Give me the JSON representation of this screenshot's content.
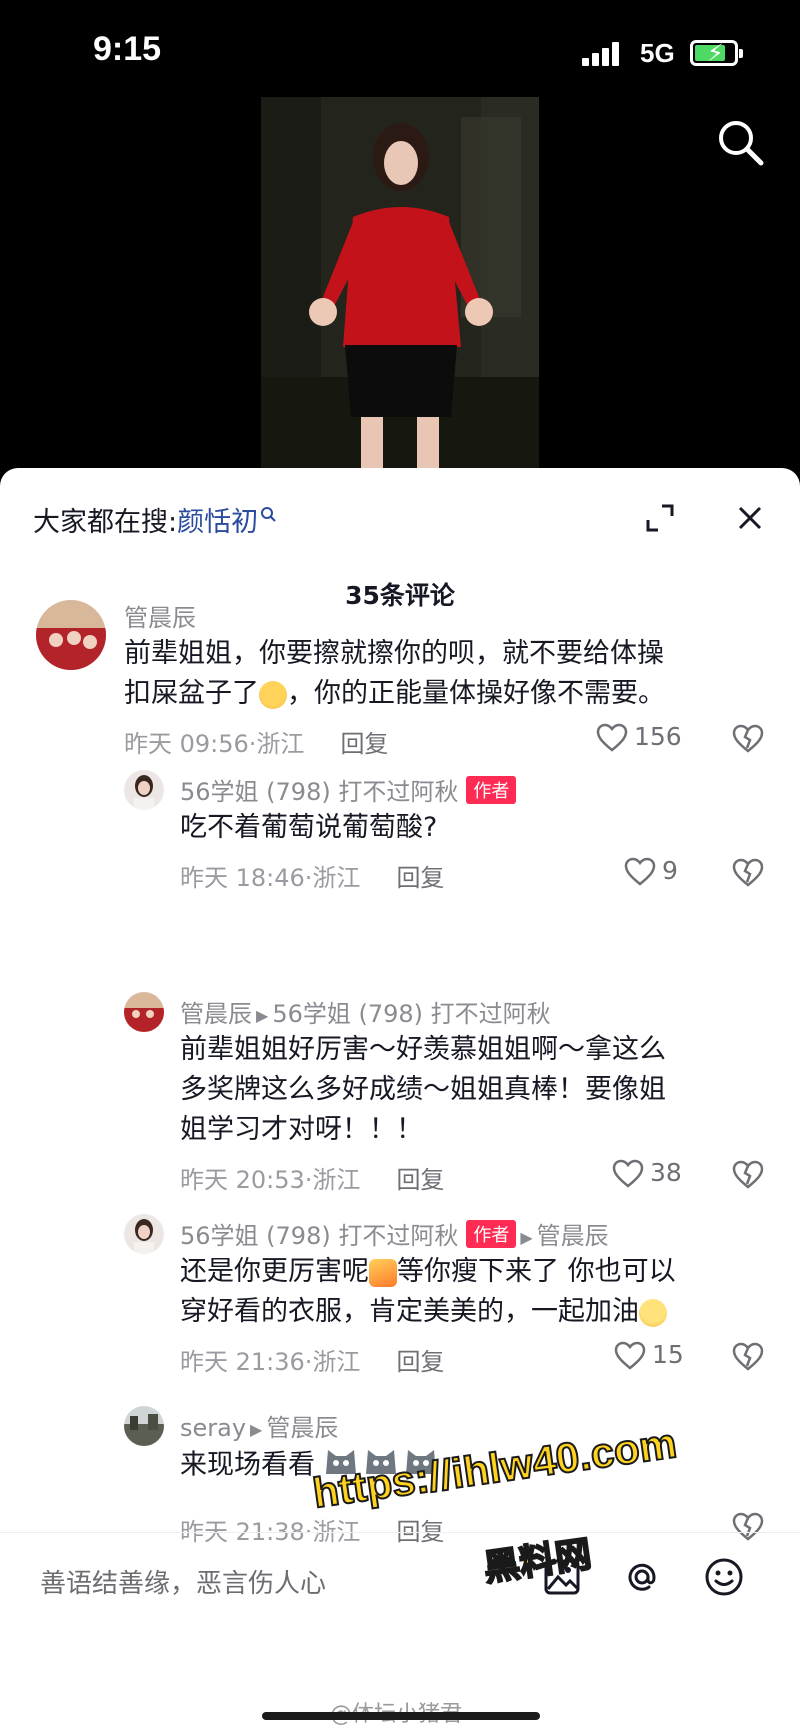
{
  "status_bar": {
    "time": "9:15",
    "network": "5G"
  },
  "sheet": {
    "hot_search_prefix": "大家都在搜:",
    "hot_search_keyword": "颜恬初",
    "comment_count_title": "35条评论"
  },
  "comments": [
    {
      "user": "管晨辰",
      "text_line1": "前辈姐姐，你要擦就擦你的呗，就不要给体操",
      "text_line2a": "扣屎盆子了",
      "text_line2b": "，你的正能量体操好像不需要。",
      "time": "昨天 09:56",
      "region": "浙江",
      "reply_label": "回复",
      "likes": "156"
    },
    {
      "user": "56学姐 (798) 打不过阿秋",
      "author_tag": "作者",
      "text": "吃不着葡萄说葡萄酸?",
      "time": "昨天 18:46",
      "region": "浙江",
      "reply_label": "回复",
      "likes": "9"
    },
    {
      "user": "管晨辰",
      "reply_to": "56学姐 (798) 打不过阿秋",
      "text_line1": "前辈姐姐好厉害～好羡慕姐姐啊～拿这么",
      "text_line2": "多奖牌这么多好成绩～姐姐真棒！要像姐",
      "text_line3": "姐学习才对呀！！！",
      "time": "昨天 20:53",
      "region": "浙江",
      "reply_label": "回复",
      "likes": "38"
    },
    {
      "user": "56学姐 (798) 打不过阿秋",
      "author_tag": "作者",
      "reply_to": "管晨辰",
      "text_line1a": "还是你更厉害呢",
      "text_line1b": "等你瘦下来了 你也可以",
      "text_line2": "穿好看的衣服，肯定美美的，一起加油",
      "time": "昨天 21:36",
      "region": "浙江",
      "reply_label": "回复",
      "likes": "15"
    },
    {
      "user": "seray",
      "reply_to": "管晨辰",
      "text": "来现场看看",
      "time": "昨天 21:38",
      "region": "浙江",
      "reply_label": "回复"
    }
  ],
  "input": {
    "placeholder": "善语结善缘，恶言伤人心"
  },
  "watermarks": {
    "url": "https://ihlw40.com",
    "site": "黑料网",
    "weibo": "@体坛小猪君"
  },
  "icons": [
    "search-icon",
    "expand-icon",
    "close-icon",
    "heart-icon",
    "broken-heart-icon",
    "image-icon",
    "at-icon",
    "emoji-icon"
  ],
  "colors": {
    "author_tag": "#fe2c55",
    "keyword": "#2a4b9e",
    "watermark": "#ffd21e"
  }
}
